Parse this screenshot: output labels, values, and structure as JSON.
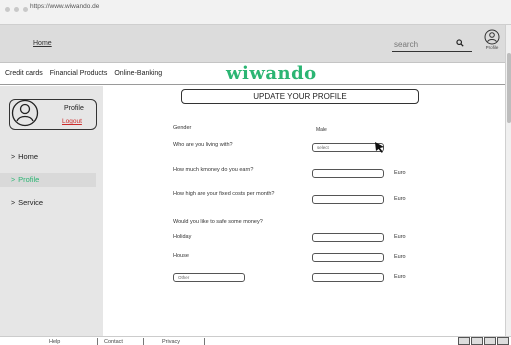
{
  "browser": {
    "url": "https://www.wiwando.de"
  },
  "topbar": {
    "home_label": "Home",
    "search_placeholder": "search",
    "profile_label": "Profile"
  },
  "nav": {
    "links": [
      "Credit cards",
      "Financial Products",
      "Online-Banking"
    ],
    "brand": "wiwando",
    "brand_color": "#2bb573"
  },
  "sidebar": {
    "profile_name": "Profile",
    "logout_label": "Logout",
    "items": [
      {
        "label": "Home"
      },
      {
        "label": "Profile",
        "active": true
      },
      {
        "label": "Service"
      }
    ]
  },
  "form": {
    "title": "UPDATE YOUR PROFILE",
    "gender_label": "Gender",
    "gender_value": "Male",
    "living_label": "Who are you living with?",
    "living_select": "select",
    "earn_label": "How much kmoney do you earn?",
    "costs_label": "How high are your fixed costs per month?",
    "save_question": "Would you like to safe some money?",
    "holiday_label": "Holiday",
    "house_label": "House",
    "other_placeholder": "Other",
    "currency": "Euro"
  },
  "footer": {
    "links": [
      "Help",
      "Contact",
      "Privacy"
    ]
  }
}
